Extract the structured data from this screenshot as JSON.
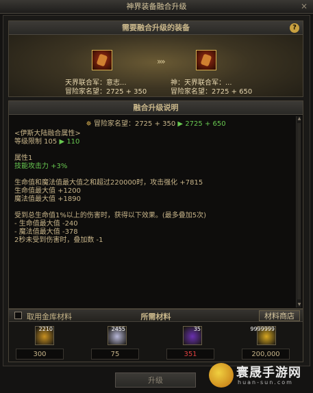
{
  "window": {
    "title": "神界装备融合升级"
  },
  "top_panel": {
    "title": "需要融合升级的装备",
    "help": "?",
    "arrow": "»»",
    "source_item": {
      "name": "天界联合军：意志...",
      "fame": "冒险家名望：2725 + 350"
    },
    "target_item": {
      "name": "神：天界联合军：...",
      "fame": "冒险家名望：2725 + 650"
    }
  },
  "desc_panel": {
    "title": "融合升级说明",
    "fame_label": "冒险家名望：2725 + 350",
    "fame_arrow": "▶",
    "fame_new": "2725 + 650",
    "lines": [
      {
        "text": "<伊斯大陆融合属性>",
        "green": ""
      },
      {
        "text": "等级限制 105 ",
        "green": "▶ 110"
      },
      {
        "text": "",
        "green": ""
      },
      {
        "text": "属性1",
        "green": ""
      },
      {
        "text": "",
        "green": "技能攻击力 +3%"
      },
      {
        "text": "",
        "green": ""
      },
      {
        "text": "生命值和魔法值最大值之和超过220000时，攻击强化 +7815",
        "green": ""
      },
      {
        "text": "生命值最大值 +1200",
        "green": ""
      },
      {
        "text": "魔法值最大值 +1890",
        "green": ""
      },
      {
        "text": "",
        "green": ""
      },
      {
        "text": "受到总生命值1%以上的伤害时，获得以下效果。(最多叠加5次)",
        "green": ""
      },
      {
        "text": "- 生命值最大值 -240",
        "green": ""
      },
      {
        "text": "- 魔法值最大值 -378",
        "green": ""
      },
      {
        "text": "2秒未受到伤害时，叠加数 -1",
        "green": ""
      }
    ]
  },
  "materials": {
    "use_bank_label": "取用金库材料",
    "title": "所需材料",
    "shop_label": "材料商店",
    "items": [
      {
        "count": "2210",
        "qty": "300",
        "icon": "gold-crystal-icon",
        "color": "#c89020",
        "short": false
      },
      {
        "count": "2455",
        "qty": "75",
        "icon": "white-orb-icon",
        "color": "#b8b8d8",
        "short": false
      },
      {
        "count": "35",
        "qty": "351",
        "icon": "purple-swirl-icon",
        "color": "#6a30b0",
        "short": true
      },
      {
        "count": "9999999",
        "qty": "200,000",
        "icon": "gold-coins-icon",
        "color": "#d8a820",
        "short": false
      }
    ]
  },
  "upgrade_button": "升级",
  "watermark": {
    "text": "寰晟手游网",
    "url": "huan-sun.com"
  }
}
